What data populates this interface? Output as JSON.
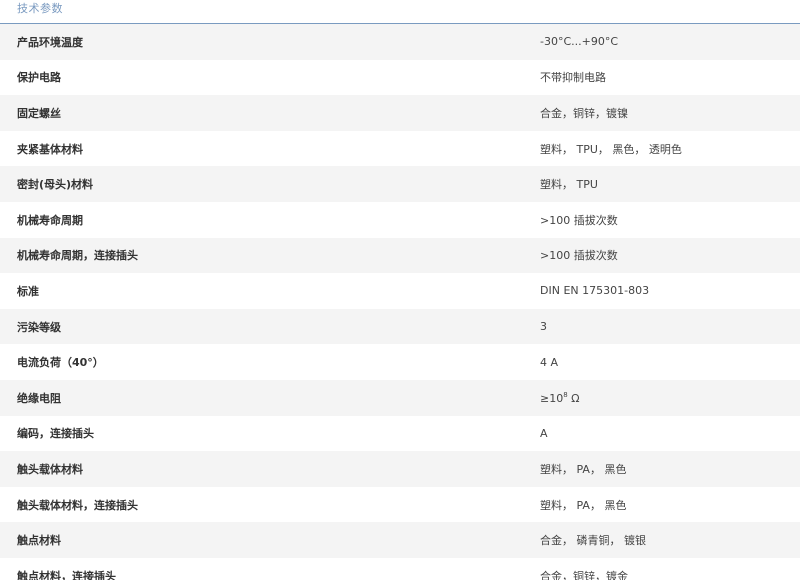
{
  "section": {
    "title": "技术参数"
  },
  "specs": [
    {
      "label": "产品环境温度",
      "value": "-30°C...+90°C"
    },
    {
      "label": "保护电路",
      "value": "不带抑制电路"
    },
    {
      "label": "固定螺丝",
      "value": "合金，铜锌，镀镍"
    },
    {
      "label": "夹紧基体材料",
      "value": "塑料， TPU， 黑色， 透明色"
    },
    {
      "label": "密封(母头)材料",
      "value": "塑料， TPU"
    },
    {
      "label": "机械寿命周期",
      "value": ">100 插拔次数"
    },
    {
      "label": "机械寿命周期，连接插头",
      "value": ">100 插拔次数"
    },
    {
      "label": "标准",
      "value": "DIN EN 175301-803"
    },
    {
      "label": "污染等级",
      "value": "3"
    },
    {
      "label": "电流负荷（40°）",
      "value": "4 A"
    },
    {
      "label": "绝缘电阻",
      "value_prefix": "≥10",
      "value_sup": "8",
      "value_suffix": " Ω"
    },
    {
      "label": "编码，连接插头",
      "value": "A"
    },
    {
      "label": "触头载体材料",
      "value": "塑料， PA， 黑色"
    },
    {
      "label": "触头载体材料，连接插头",
      "value": "塑料， PA， 黑色"
    },
    {
      "label": "触点材料",
      "value": "合金， 磷青铜， 镀银"
    },
    {
      "label": "触点材料，连接插头",
      "value": "合金，铜锌，镀金"
    }
  ]
}
